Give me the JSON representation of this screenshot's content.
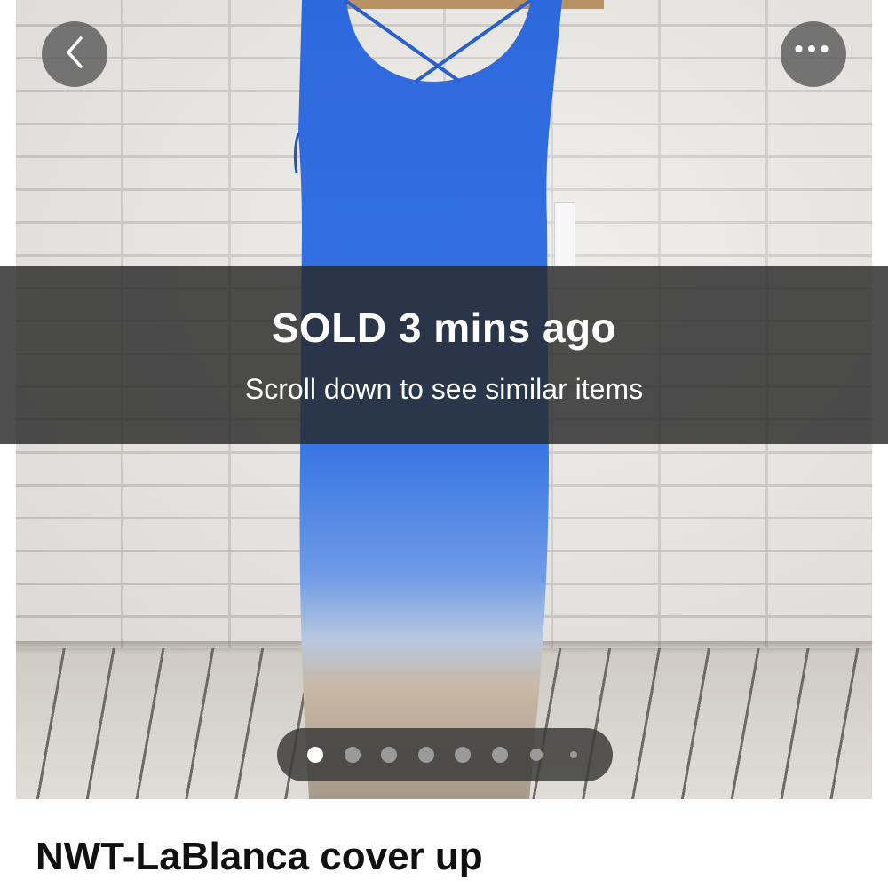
{
  "status_banner": {
    "title": "SOLD 3 mins ago",
    "subtitle": "Scroll down to see similar items"
  },
  "header": {
    "back_icon": "chevron-left-icon",
    "more_icon": "more-horizontal-icon",
    "more_glyph": "•••"
  },
  "carousel": {
    "total_pages": 8,
    "current_page": 1
  },
  "listing": {
    "title": "NWT-LaBlanca cover up"
  },
  "colors": {
    "dress_blue": "#2f6fe0",
    "overlay": "#282828",
    "accent_text": "#ffffff"
  }
}
